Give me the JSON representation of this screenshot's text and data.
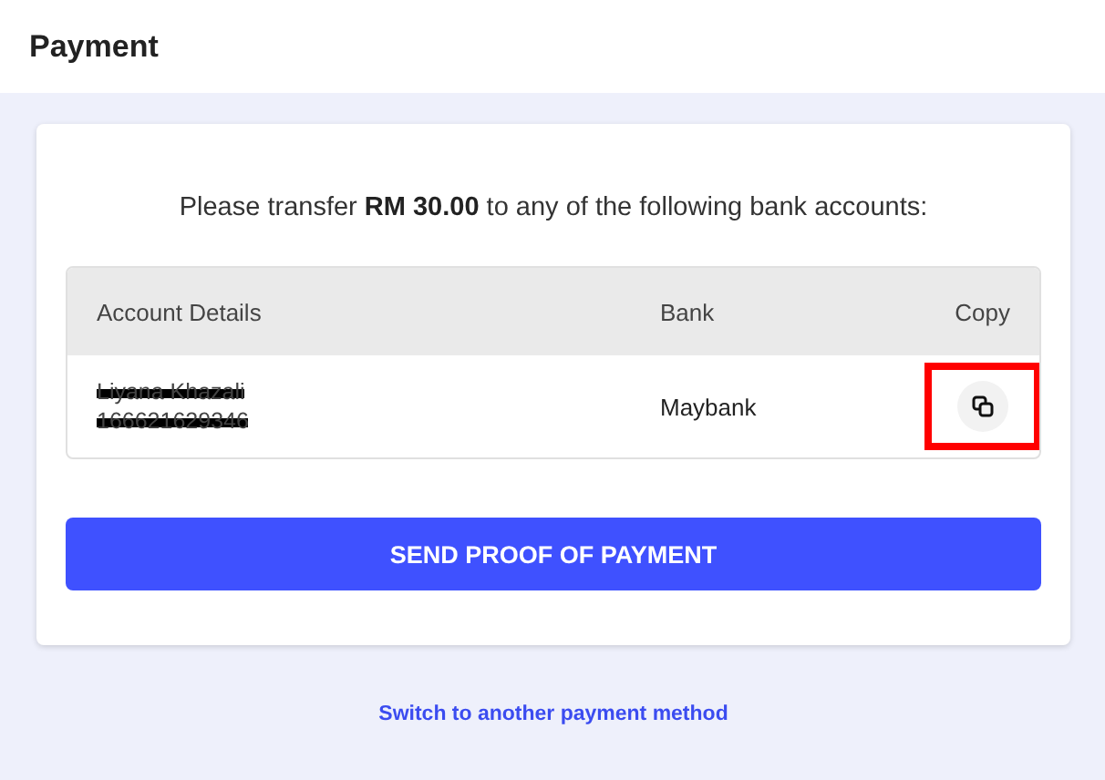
{
  "header": {
    "title": "Payment"
  },
  "instruction": "Please transfer **RM 30.00** to any of the following bank accounts:",
  "table": {
    "columns": [
      "Account Details",
      "Bank",
      "Copy"
    ],
    "rows": [
      {
        "account_name": "Liyana Khazali",
        "account_number": "166621629346",
        "redacted": true,
        "bank": "Maybank",
        "highlighted": true
      }
    ]
  },
  "primary_button": "SEND PROOF OF PAYMENT",
  "switch_link": "Switch to another payment method"
}
